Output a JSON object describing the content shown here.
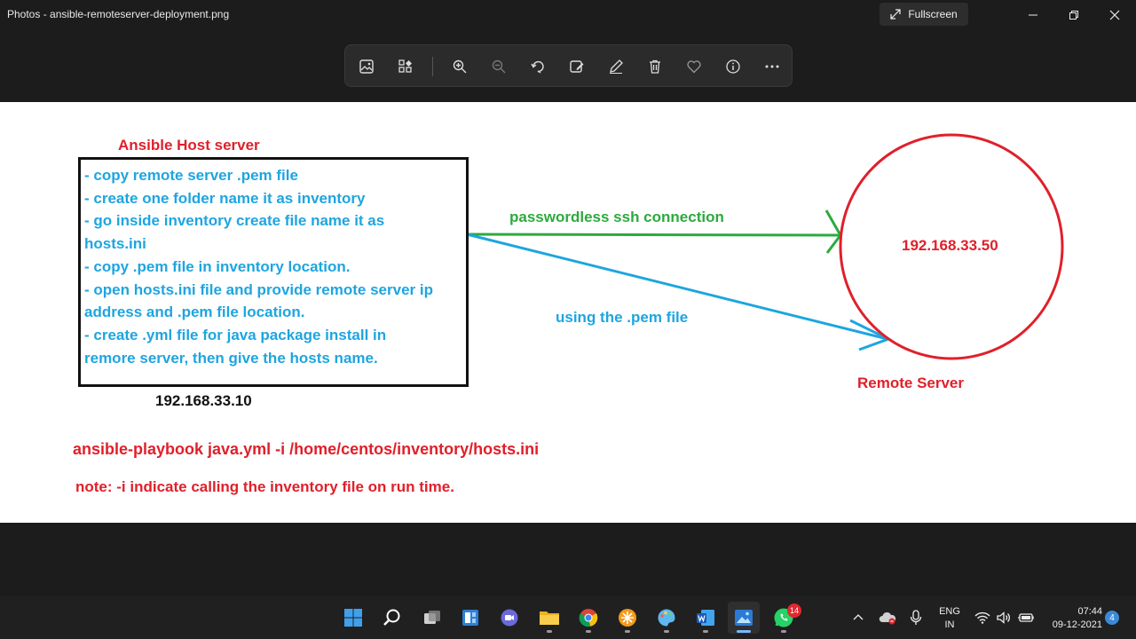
{
  "window": {
    "title": "Photos - ansible-remoteserver-deployment.png",
    "fullscreen_label": "Fullscreen"
  },
  "toolbar": {
    "tools": [
      "image-icon",
      "collection-icon",
      "zoom-in-icon",
      "zoom-out-icon",
      "rotate-icon",
      "edit-image-icon",
      "draw-icon",
      "delete-icon",
      "favorite-icon",
      "info-icon",
      "more-icon"
    ]
  },
  "diagram": {
    "host_title": "Ansible Host server",
    "host_lines": [
      "- copy remote server .pem file",
      "- create one folder name it as inventory",
      "- go inside inventory create file name it as",
      "hosts.ini",
      "- copy .pem file in inventory location.",
      "- open hosts.ini file and provide remote server ip",
      "address and .pem file location.",
      "- create .yml file for java package install in",
      "remore server, then give the hosts name."
    ],
    "host_ip": "192.168.33.10",
    "arrow_green_label": "passwordless ssh connection",
    "arrow_blue_label": "using the .pem file",
    "remote_ip": "192.168.33.50",
    "remote_label": "Remote Server",
    "command": "ansible-playbook java.yml -i /home/centos/inventory/hosts.ini",
    "note": "note: -i indicate calling the inventory file on run time.",
    "colors": {
      "red": "#e0202a",
      "blue": "#1ea5e0",
      "green": "#2caa3e"
    }
  },
  "taskbar": {
    "apps": [
      "windows-start-icon",
      "search-icon",
      "task-view-icon",
      "widgets-icon",
      "teams-chat-icon",
      "file-explorer-icon",
      "chrome-icon",
      "app-icon",
      "paint-icon",
      "word-icon",
      "photos-icon",
      "whatsapp-icon"
    ],
    "whatsapp_badge": "14",
    "language_line1": "ENG",
    "language_line2": "IN",
    "time": "07:44",
    "date": "09-12-2021",
    "notification_count": "4"
  }
}
